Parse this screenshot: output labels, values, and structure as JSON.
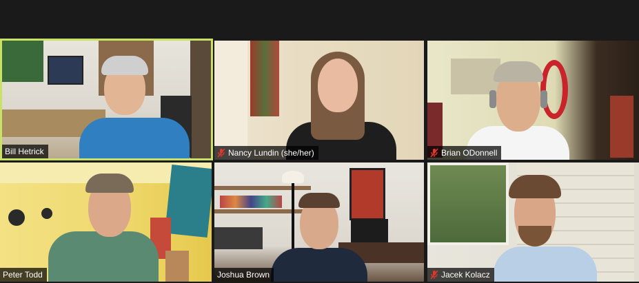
{
  "participants": [
    {
      "name": "Bill Hetrick",
      "muted": false,
      "active_speaker": true
    },
    {
      "name": "Nancy Lundin (she/her)",
      "muted": true,
      "active_speaker": false
    },
    {
      "name": "Brian ODonnell",
      "muted": true,
      "active_speaker": false
    },
    {
      "name": "Peter Todd",
      "muted": false,
      "active_speaker": false
    },
    {
      "name": "Joshua Brown",
      "muted": false,
      "active_speaker": false
    },
    {
      "name": "Jacek Kolacz",
      "muted": true,
      "active_speaker": false
    }
  ],
  "colors": {
    "active_border": "#c9e265",
    "mute_icon": "#e0372c",
    "background": "#1a1a1a"
  },
  "icons": {
    "mute": "microphone-muted-icon"
  }
}
